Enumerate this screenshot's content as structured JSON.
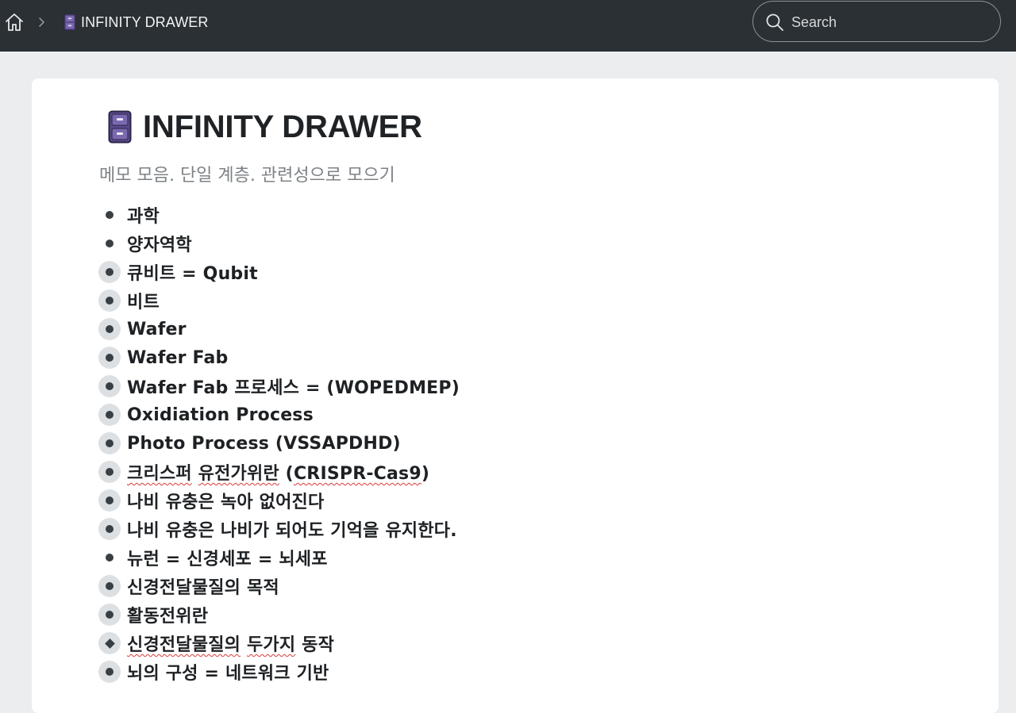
{
  "topbar": {
    "breadcrumb": {
      "home_icon": "home-icon",
      "separator_icon": "chevron-right-icon",
      "current_icon": "file-cabinet-icon",
      "current_label": "INFINITY DRAWER"
    },
    "search": {
      "icon": "search-icon",
      "placeholder": "Search",
      "value": ""
    }
  },
  "document": {
    "title_icon": "file-cabinet-icon",
    "title": "INFINITY DRAWER",
    "description": "메모 모음. 단일 계층. 관련성으로 모으기",
    "items": [
      {
        "label": "과학",
        "bullet": "dot",
        "collapsed": false
      },
      {
        "label": "양자역학",
        "bullet": "dot",
        "collapsed": false
      },
      {
        "label": "큐비트 = Qubit",
        "bullet": "dot",
        "collapsed": true
      },
      {
        "label": "비트",
        "bullet": "dot",
        "collapsed": true
      },
      {
        "label": "Wafer",
        "bullet": "dot",
        "collapsed": true
      },
      {
        "label": "Wafer Fab",
        "bullet": "dot",
        "collapsed": true
      },
      {
        "label": "Wafer Fab 프로세스 = (WOPEDMEP)",
        "bullet": "dot",
        "collapsed": true
      },
      {
        "label": "Oxidiation Process",
        "bullet": "dot",
        "collapsed": true
      },
      {
        "label": "Photo Process (VSSAPDHD)",
        "bullet": "dot",
        "collapsed": true
      },
      {
        "label": "크리스퍼 유전가위란 (CRISPR-Cas9)",
        "bullet": "dot",
        "collapsed": true
      },
      {
        "label": "나비 유충은 녹아 없어진다",
        "bullet": "dot",
        "collapsed": true
      },
      {
        "label": "나비 유충은 나비가 되어도 기억을 유지한다.",
        "bullet": "dot",
        "collapsed": true
      },
      {
        "label": "뉴런 = 신경세포 = 뇌세포",
        "bullet": "dot",
        "collapsed": false
      },
      {
        "label": "신경전달물질의 목적",
        "bullet": "dot",
        "collapsed": true
      },
      {
        "label": "활동전위란",
        "bullet": "dot",
        "collapsed": true
      },
      {
        "label": "신경전달물질의 두가지 동작",
        "bullet": "diamond",
        "collapsed": true
      },
      {
        "label": "뇌의 구성 = 네트워크 기반",
        "bullet": "dot",
        "collapsed": true
      }
    ]
  }
}
